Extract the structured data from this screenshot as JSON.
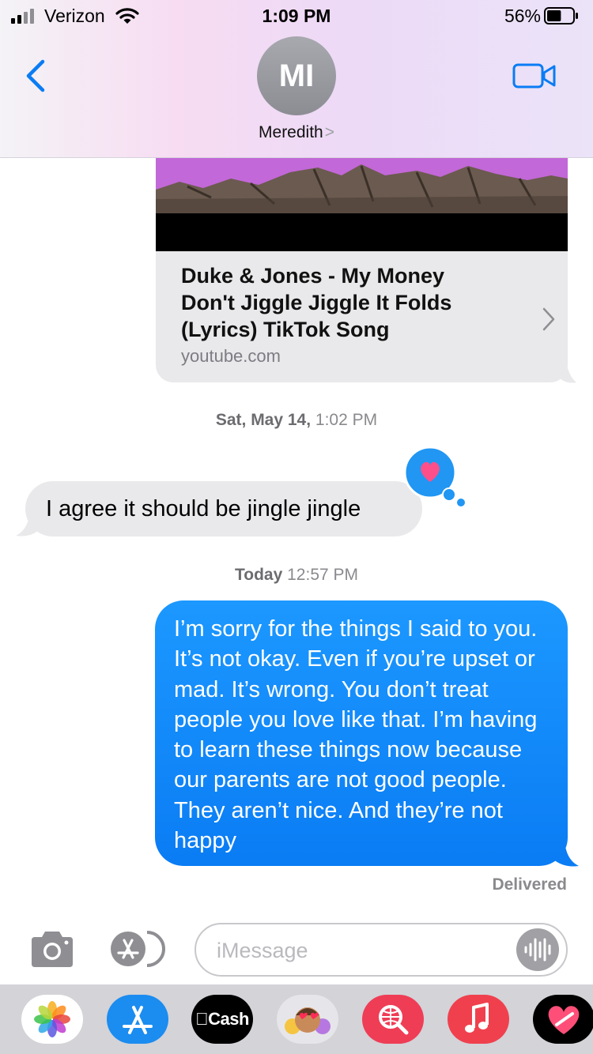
{
  "status_bar": {
    "carrier": "Verizon",
    "time": "1:09 PM",
    "battery_percent": "56%",
    "battery_level": 0.56
  },
  "header": {
    "avatar_initials": "MI",
    "contact_name": "Meredith",
    "contact_chevron": ">"
  },
  "conversation": {
    "link_preview": {
      "title": "Duke & Jones - My Money Don't Jiggle Jiggle It Folds (Lyrics) TikTok Song",
      "domain": "youtube.com"
    },
    "timestamp_1": {
      "day": "Sat, May 14,",
      "time": "1:02 PM"
    },
    "incoming_message": "I agree it should be jingle jingle",
    "tapback": "heart",
    "timestamp_2": {
      "day": "Today",
      "time": "12:57 PM"
    },
    "outgoing_message": "I’m sorry for the things I said to you. It’s not okay. Even if you’re upset or mad. It’s wrong. You don’t treat people you love like that. I’m having to learn these things now because our parents are not good people. They aren’t nice. And they’re not happy",
    "delivery_status": "Delivered"
  },
  "input_bar": {
    "placeholder": "iMessage"
  },
  "app_drawer": {
    "apps": [
      "photos-icon",
      "app-store-icon",
      "apple-cash-icon",
      "memoji-icon",
      "image-search-icon",
      "music-icon",
      "digital-touch-icon"
    ],
    "cash_label": "Cash"
  },
  "colors": {
    "imessage_blue": "#0a7cf4",
    "incoming_gray": "#e9e9eb",
    "tapback_blue": "#2196f3",
    "heart_pink": "#ff4f8b"
  }
}
